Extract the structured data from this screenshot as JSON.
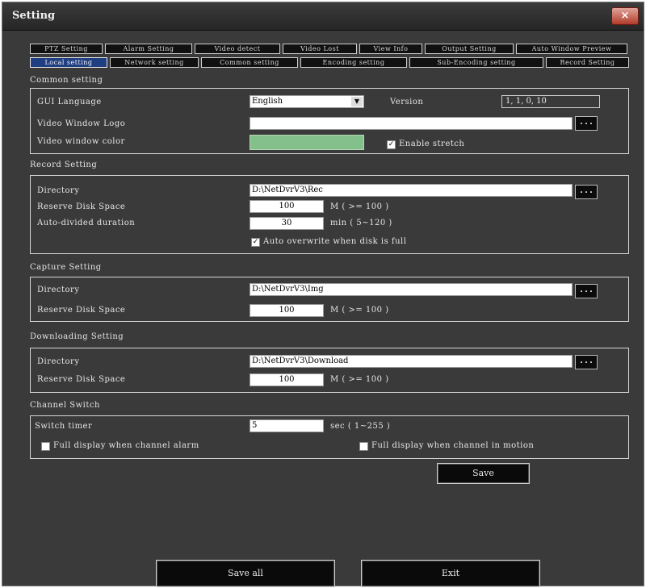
{
  "window": {
    "title": "Setting",
    "close_icon": "×"
  },
  "tabs_row1": [
    "PTZ Setting",
    "Alarm Setting",
    "Video detect",
    "Video Lost",
    "View Info",
    "Output Setting",
    "Auto Window Preview"
  ],
  "tabs_row2": [
    "Local setting",
    "Network setting",
    "Common setting",
    "Encoding setting",
    "Sub-Encoding setting",
    "Record Setting"
  ],
  "common": {
    "title": "Common setting",
    "gui_language_label": "GUI Language",
    "gui_language_value": "English",
    "version_label": "Version",
    "version_value": "1, 1, 0, 10",
    "logo_label": "Video Window Logo",
    "logo_value": "",
    "color_label": "Video window color",
    "window_color": "#84c08c",
    "stretch_label": "Enable stretch",
    "stretch_checked": "✓",
    "browse": "..."
  },
  "record": {
    "title": "Record Setting",
    "dir_label": "Directory",
    "dir_value": "D:\\NetDvrV3\\Rec",
    "reserve_label": "Reserve Disk Space",
    "reserve_value": "100",
    "reserve_unit": "M ( >= 100 )",
    "auto_label": "Auto-divided duration",
    "auto_value": "30",
    "auto_unit": "min ( 5~120 )",
    "overwrite_label": "Auto overwrite when disk is full",
    "overwrite_checked": "✓",
    "browse": "..."
  },
  "capture": {
    "title": "Capture Setting",
    "dir_label": "Directory",
    "dir_value": "D:\\NetDvrV3\\Img",
    "reserve_label": "Reserve Disk Space",
    "reserve_value": "100",
    "reserve_unit": "M ( >= 100 )",
    "browse": "..."
  },
  "download": {
    "title": "Downloading Setting",
    "dir_label": "Directory",
    "dir_value": "D:\\NetDvrV3\\Download",
    "reserve_label": "Reserve Disk Space",
    "reserve_value": "100",
    "reserve_unit": "M ( >= 100 )",
    "browse": "..."
  },
  "channel": {
    "title": "Channel Switch",
    "timer_label": "Switch timer",
    "timer_value": "5",
    "timer_unit": "sec ( 1~255 )",
    "alarm_label": "Full display when channel alarm",
    "motion_label": "Full display when channel in motion"
  },
  "buttons": {
    "save": "Save",
    "save_all": "Save all",
    "exit": "Exit"
  }
}
